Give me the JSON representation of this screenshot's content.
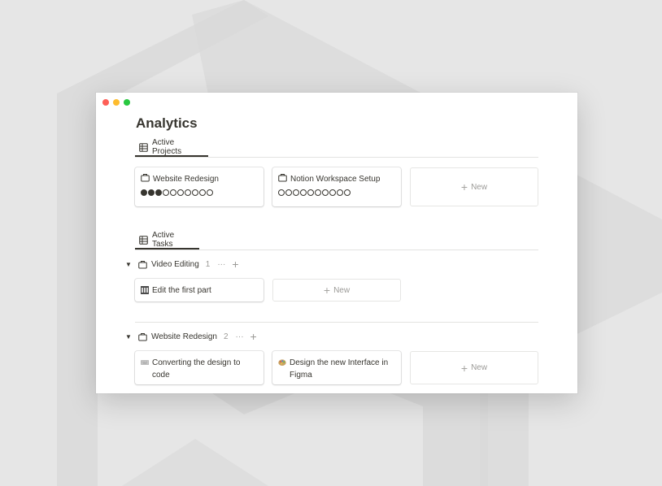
{
  "page": {
    "title": "Analytics"
  },
  "projects": {
    "tab_label": "Active Projects",
    "cards": [
      {
        "title": "Website Redesign",
        "progress_filled": 3,
        "progress_total": 10
      },
      {
        "title": "Notion Workspace Setup",
        "progress_filled": 0,
        "progress_total": 10
      }
    ],
    "new_label": "New"
  },
  "tasks": {
    "tab_label": "Active Tasks",
    "groups": [
      {
        "name": "Video Editing",
        "count": "1",
        "more": "···",
        "cards": [
          {
            "title": "Edit the first part",
            "icon": "film-frames-icon"
          }
        ],
        "new_label": "New"
      },
      {
        "name": "Website Redesign",
        "count": "2",
        "more": "···",
        "cards": [
          {
            "title": "Converting the design to code",
            "icon": "keyboard-icon"
          },
          {
            "title": "Design the new Interface in Figma",
            "icon": "paint-palette-icon"
          }
        ],
        "new_label": "New"
      }
    ]
  },
  "colors": {
    "text": "#37352f",
    "muted": "#9b9a97",
    "accent_red": "#fe5f57",
    "accent_yellow": "#febc2e",
    "accent_green": "#28c840"
  }
}
